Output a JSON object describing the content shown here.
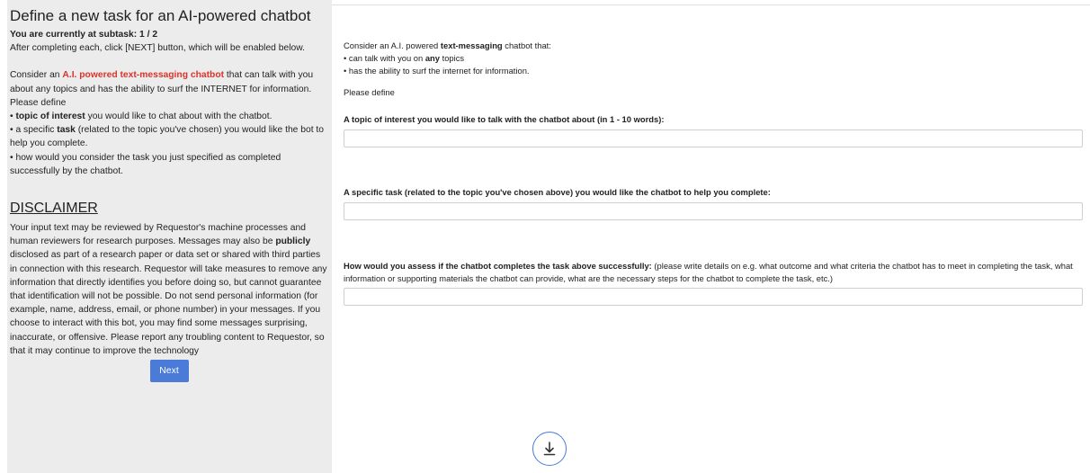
{
  "sidebar": {
    "title": "Define a new task for an AI-powered chatbot",
    "subtask_prefix": "You are currently at subtask: ",
    "subtask_value": "1 / 2",
    "instruction": "After completing each, click [NEXT] button, which will be enabled below.",
    "intro_1": "Consider an ",
    "intro_highlight": "A.I. powered text-messaging chatbot",
    "intro_2": " that can talk with you about any topics and has the ability to surf the INTERNET for information.",
    "please_define": "Please define",
    "bullet1_bold": "topic of interest",
    "bullet1_rest": " you would like to chat about with the chatbot.",
    "bullet2_pre": "a specific ",
    "bullet2_bold": "task",
    "bullet2_rest": " (related to the topic you've chosen) you would like the bot to help you complete.",
    "bullet3": "how would you consider the task you just specified as completed successfully by the chatbot.",
    "disclaimer_title": "DISCLAIMER",
    "disclaimer_1": "Your input text may be reviewed by Requestor's machine processes and human reviewers for research purposes. Messages may also be ",
    "disclaimer_bold": "publicly",
    "disclaimer_2": " disclosed as part of a research paper or data set or shared with third parties in connection with this research. Requestor will take measures to remove any information that directly identifies you before doing so, but cannot guarantee that identification will not be possible. Do not send personal information (for example, name, address, email, or phone number) in your messages. If you choose to interact with this bot, you may find some messages surprising, inaccurate, or offensive. Please report any troubling content to Requestor, so that it may continue to improve the technology",
    "next_label": "Next"
  },
  "main": {
    "intro_1": "Consider an A.I. powered ",
    "intro_bold": "text-messaging",
    "intro_2": " chatbot that:",
    "bullet1_pre": "• can talk with you on ",
    "bullet1_bold": "any",
    "bullet1_post": " topics",
    "bullet2": "• has the ability to surf the internet for information.",
    "please_define": "Please define",
    "q1_label": "A topic of interest you would like to talk with the chatbot about (in 1 - 10 words):",
    "q1_value": "",
    "q2_label": "A specific task (related to the topic you've chosen above) you would like the chatbot to help you complete:",
    "q2_value": "",
    "q3_label_bold": "How would you assess if the chatbot completes the task above successfully:",
    "q3_label_rest": " (please write details on e.g. what outcome and what criteria the chatbot has to meet in completing the task, what information or supporting materials the chatbot can provide, what are the necessary steps for the chatbot to complete the task, etc.)",
    "q3_value": ""
  },
  "icons": {
    "download": "download-arrow-icon"
  },
  "colors": {
    "sidebar_bg": "#ececec",
    "highlight_red": "#d9342b",
    "accent_blue": "#4a7bd8"
  }
}
